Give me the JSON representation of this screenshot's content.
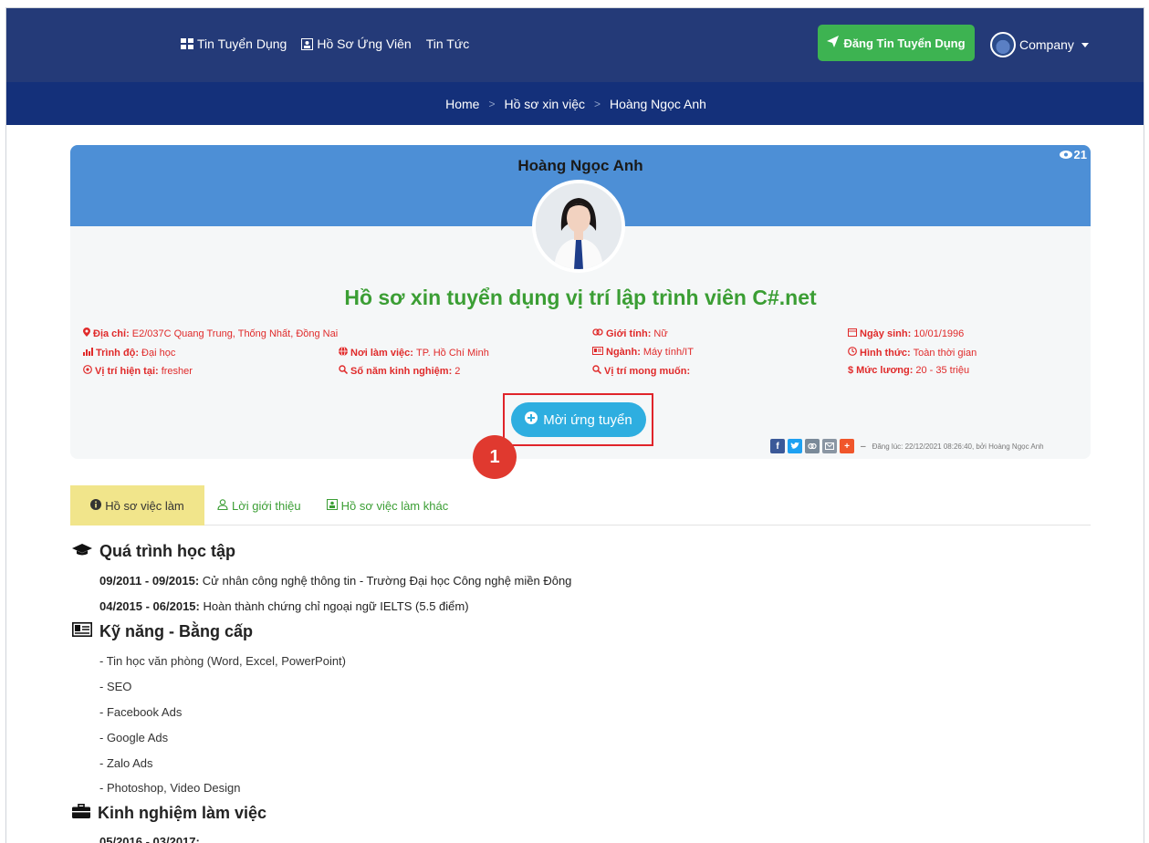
{
  "nav": {
    "links": [
      {
        "icon": "grid-icon",
        "label": "Tin Tuyển Dụng"
      },
      {
        "icon": "id-card-icon",
        "label": "Hồ Sơ Ứng Viên"
      },
      {
        "icon": "",
        "label": "Tin Tức"
      }
    ],
    "post_button": "Đăng Tin Tuyển Dụng",
    "account_label": "Company"
  },
  "breadcrumb": {
    "items": [
      "Home",
      "Hồ sơ xin việc",
      "Hoàng Ngọc Anh"
    ]
  },
  "profile": {
    "name": "Hoàng Ngọc Anh",
    "views": "21",
    "title": "Hồ sơ xin tuyển dụng vị trí lập trình viên C#.net",
    "info": {
      "address_label": "Địa chỉ:",
      "address": "E2/037C Quang Trung, Thống Nhất, Đồng Nai",
      "gender_label": "Giới tính:",
      "gender": "Nữ",
      "dob_label": "Ngày sinh:",
      "dob": "10/01/1996",
      "level_label": "Trình độ:",
      "level": "Đại học",
      "workplace_label": "Nơi làm việc:",
      "workplace": "TP. Hồ Chí Minh",
      "industry_label": "Ngành:",
      "industry": "Máy tính/IT",
      "type_label": "Hình thức:",
      "type": "Toàn thời gian",
      "position_label": "Vị trí hiện tại:",
      "position": "fresher",
      "exp_label": "Số năm kinh nghiệm:",
      "exp": "2",
      "desired_label": "Vị trí mong muốn:",
      "desired": "",
      "salary_label": "Mức lương:",
      "salary": "20 - 35 triệu"
    },
    "invite_button": "Mời ứng tuyển",
    "step_badge": "1",
    "posted_text": "Đăng lúc: 22/12/2021 08:26:40, bởi Hoàng Ngọc Anh"
  },
  "tabs": [
    {
      "icon": "info-icon",
      "label": "Hồ sơ việc làm"
    },
    {
      "icon": "user-icon",
      "label": "Lời giới thiệu"
    },
    {
      "icon": "id-card-icon",
      "label": "Hồ sơ việc làm khác"
    }
  ],
  "education": {
    "title": "Quá trình học tập",
    "items": [
      {
        "period": "09/2011 - 09/2015:",
        "text": "Cử nhân công nghệ thông tin - Trường Đại học Công nghệ miền Đông"
      },
      {
        "period": "04/2015 - 06/2015:",
        "text": "Hoàn thành chứng chỉ ngoại ngữ IELTS (5.5 điểm)"
      }
    ]
  },
  "skills": {
    "title": "Kỹ năng - Bằng cấp",
    "items": [
      "- Tin học văn phòng (Word, Excel, PowerPoint)",
      "- SEO",
      "- Facebook Ads",
      "- Google Ads",
      "- Zalo Ads",
      "- Photoshop, Video Design"
    ]
  },
  "experience": {
    "title": "Kinh nghiệm làm việc",
    "first_period": "05/2016 - 03/2017:"
  },
  "colors": {
    "nav_bg": "#243a78",
    "breadcrumb_bg": "#14307a",
    "accent_green": "#3db351",
    "header_blue": "#4d8fd6",
    "info_red": "#e02a2a",
    "title_green": "#3b9e34",
    "invite_blue": "#2eaee0"
  }
}
